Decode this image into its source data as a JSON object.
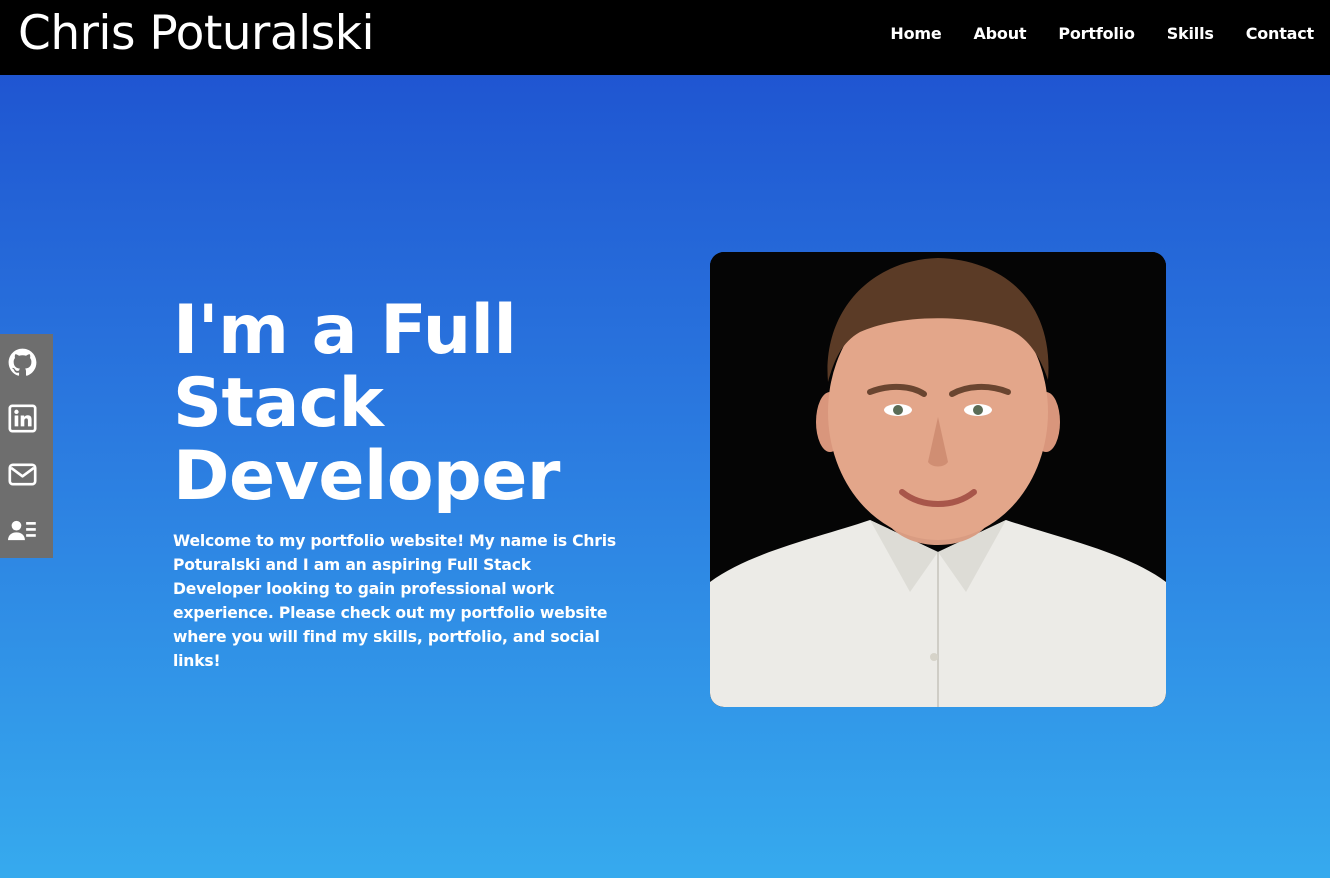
{
  "header": {
    "brand": "Chris Poturalski",
    "nav": [
      "Home",
      "About",
      "Portfolio",
      "Skills",
      "Contact"
    ]
  },
  "social": [
    {
      "icon": "github-icon"
    },
    {
      "icon": "linkedin-icon"
    },
    {
      "icon": "email-icon"
    },
    {
      "icon": "resume-icon"
    }
  ],
  "hero": {
    "title_line1": "I'm a Full",
    "title_line2": "Stack",
    "title_line3": "Developer",
    "description": "Welcome to my portfolio website! My name is Chris Poturalski and I am an aspiring Full Stack Developer looking to gain professional work experience. Please check out my portfolio website where you will find my skills, portfolio, and social links!"
  },
  "colors": {
    "header_bg": "#000000",
    "gradient_top": "#1f55d1",
    "gradient_bottom": "#36aaee",
    "social_bg": "#6e6e6e",
    "text": "#ffffff"
  }
}
